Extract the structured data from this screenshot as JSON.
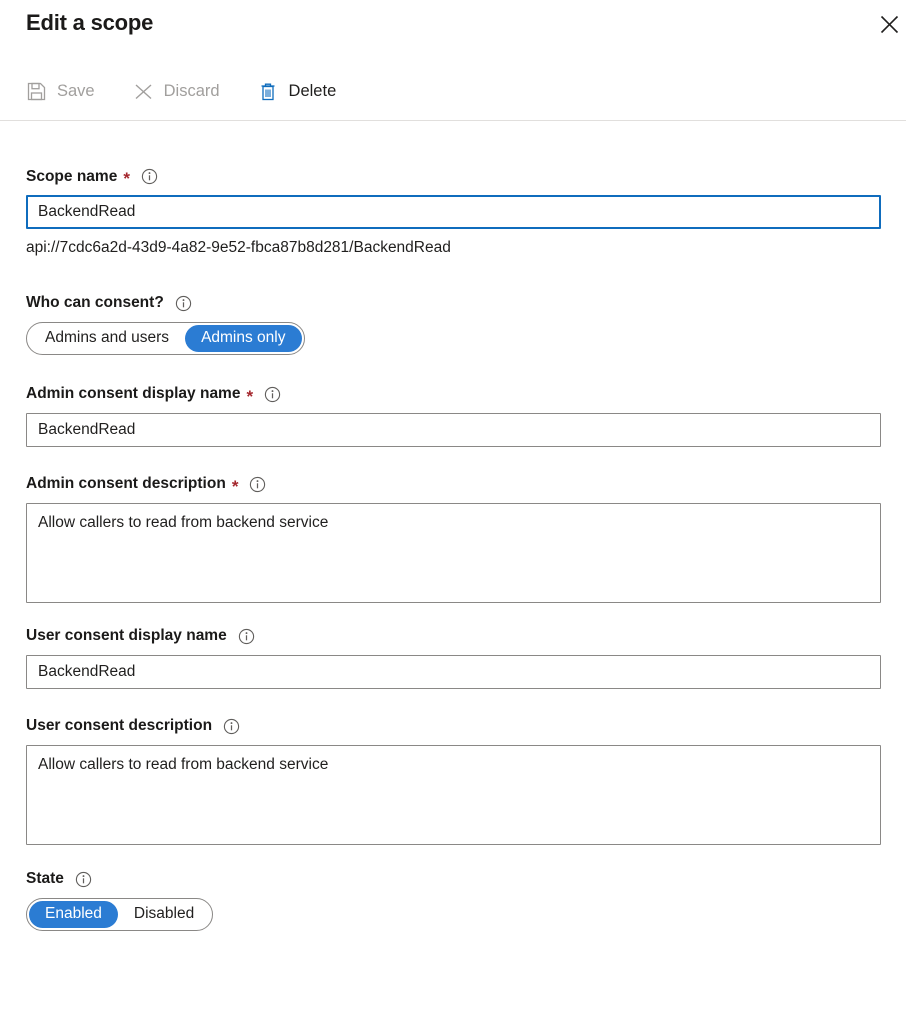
{
  "header": {
    "title": "Edit a scope",
    "close_icon": "close-icon"
  },
  "toolbar": {
    "items": [
      {
        "label": "Save",
        "icon": "save-floppy-icon",
        "enabled": false
      },
      {
        "label": "Discard",
        "icon": "discard-x-icon",
        "enabled": false
      },
      {
        "label": "Delete",
        "icon": "delete-trash-icon",
        "enabled": true
      }
    ]
  },
  "form": {
    "scope_name": {
      "label": "Scope name",
      "required_marker": "*",
      "info_icon": "info-icon",
      "value": "BackendRead",
      "placeholder": "",
      "helper_text": "api://7cdc6a2d-43d9-4a82-9e52-fbca87b8d281/BackendRead"
    },
    "who_can_consent": {
      "label": "Who can consent?",
      "info_icon": "info-icon",
      "options": [
        "Admins and users",
        "Admins only"
      ],
      "selected": "Admins only"
    },
    "admin_consent_display_name": {
      "label": "Admin consent display name",
      "required_marker": "*",
      "info_icon": "info-icon",
      "value": "BackendRead",
      "placeholder": ""
    },
    "admin_consent_description": {
      "label": "Admin consent description",
      "required_marker": "*",
      "info_icon": "info-icon",
      "value": "Allow callers to read from backend service",
      "placeholder": ""
    },
    "user_consent_display_name": {
      "label": "User consent display name",
      "info_icon": "info-icon",
      "value": "BackendRead",
      "placeholder": ""
    },
    "user_consent_description": {
      "label": "User consent description",
      "info_icon": "info-icon",
      "value": "Allow callers to read from backend service",
      "placeholder": ""
    },
    "state": {
      "label": "State",
      "info_icon": "info-icon",
      "options": [
        "Enabled",
        "Disabled"
      ],
      "selected": "Enabled"
    }
  },
  "colors": {
    "accent_blue": "#2b7cd3",
    "focus_blue": "#0f6cbd",
    "required_red": "#a4262c",
    "disabled_grey": "#a19f9d",
    "border_grey": "#8a8886",
    "divider_grey": "#e1dfdd"
  }
}
